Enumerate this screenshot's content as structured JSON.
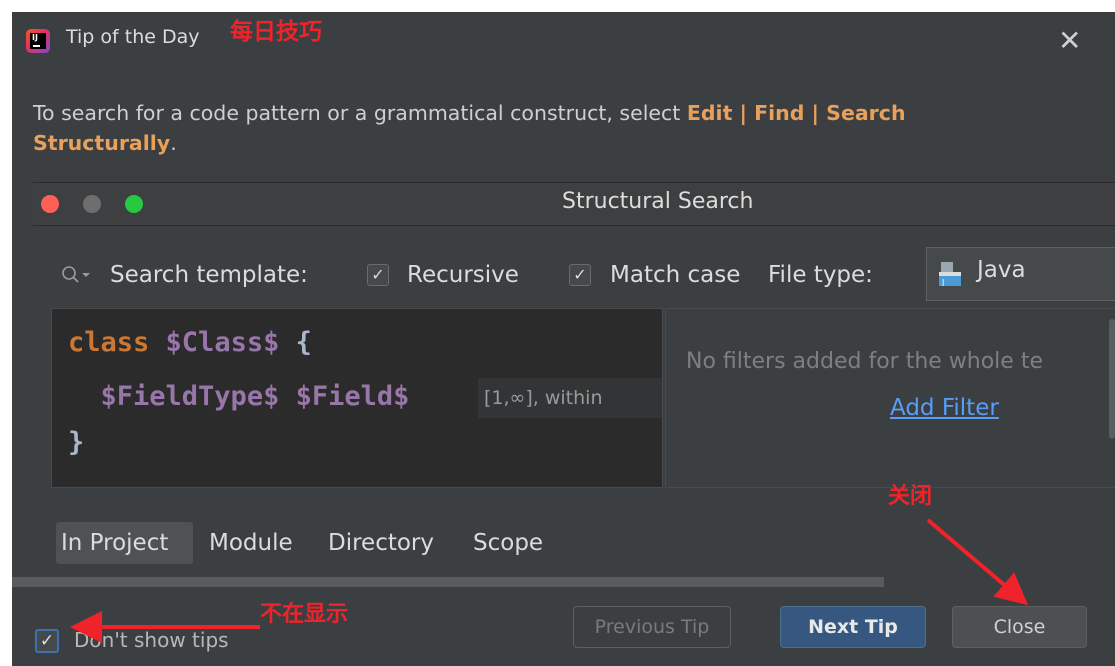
{
  "window": {
    "title": "Tip of the Day",
    "close_icon": "close-icon",
    "app_icon_letters": "IJ"
  },
  "annotations": {
    "title_note": "每日技巧",
    "close_note": "关闭",
    "dont_show_note": "不在显示",
    "color": "#f0232a"
  },
  "tip": {
    "text_before": "To search for a code pattern or a grammatical construct, select ",
    "menu_path": "Edit | Find | Search Structurally",
    "text_after": ".",
    "highlight_color": "#e8a05a"
  },
  "structural_search": {
    "title": "Structural Search",
    "search_template_label": "Search template:",
    "recursive_label": "Recursive",
    "recursive_checked": true,
    "match_case_label": "Match case",
    "match_case_checked": true,
    "file_type_label": "File type:",
    "file_type_value": "Java",
    "code": {
      "line1_keyword": "class",
      "line1_var": "$Class$",
      "line1_brace": "{",
      "line2_var1": "$FieldType$",
      "line2_var2": "$Field$",
      "line2_hint": "[1,∞], within",
      "line3_brace": "}"
    },
    "filters_message": "No filters added for the whole te",
    "add_filter_label": "Add Filter",
    "scopes": [
      "In Project",
      "Module",
      "Directory",
      "Scope"
    ],
    "selected_scope": "In Project"
  },
  "footer": {
    "dont_show_label": "Don't show tips",
    "dont_show_checked": true,
    "previous_label": "Previous Tip",
    "next_label": "Next Tip",
    "close_label": "Close"
  }
}
